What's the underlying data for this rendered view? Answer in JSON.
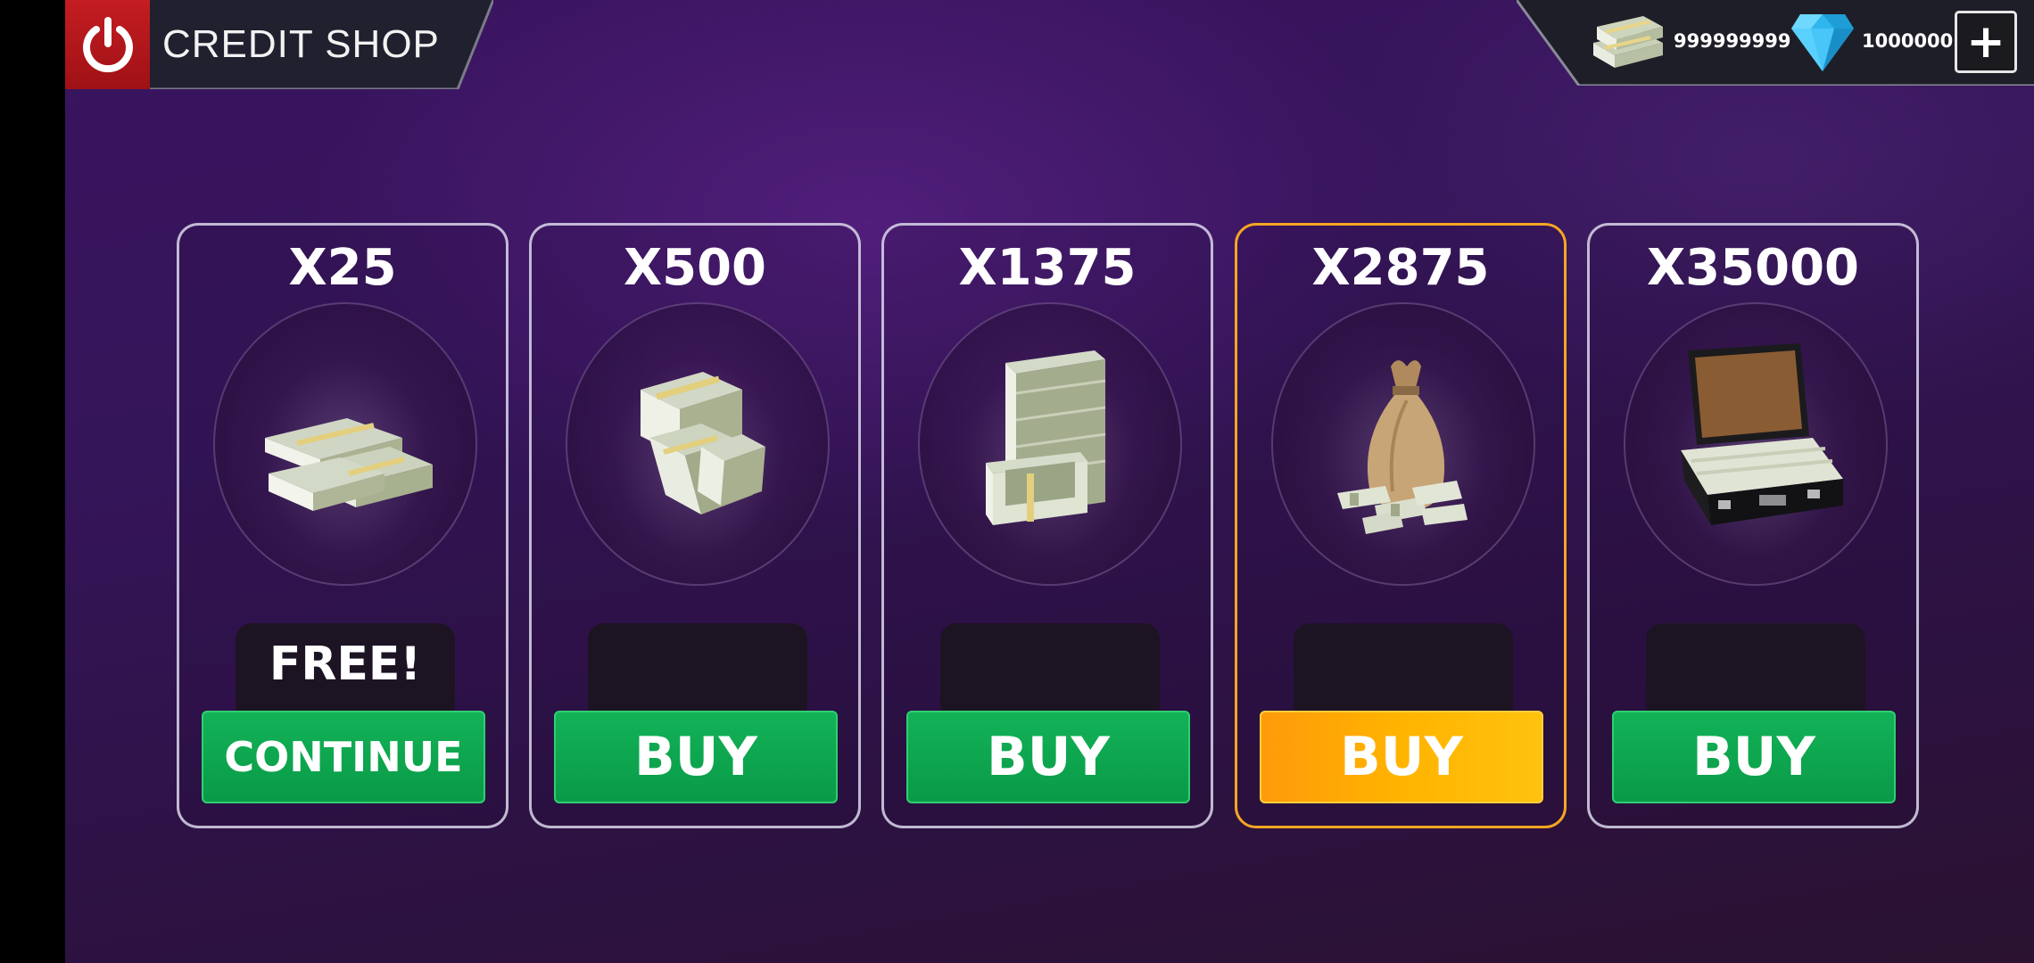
{
  "header": {
    "title": "CREDIT SHOP"
  },
  "currency": {
    "cash_amount": "999999999",
    "gem_amount": "1000000",
    "add_label": "+"
  },
  "colors": {
    "accent_green": "#0a9a47",
    "accent_orange": "#ffb400",
    "power_red": "#c41d22",
    "featured_border": "#f5a623"
  },
  "cards": [
    {
      "amount": "X25",
      "icon": "cash-stacks-icon",
      "price": "FREE!",
      "button": "CONTINUE",
      "featured": false
    },
    {
      "amount": "X500",
      "icon": "cash-bundles-icon",
      "price": "",
      "button": "BUY",
      "featured": false
    },
    {
      "amount": "X1375",
      "icon": "cash-pile-icon",
      "price": "",
      "button": "BUY",
      "featured": false
    },
    {
      "amount": "X2875",
      "icon": "money-bag-icon",
      "price": "",
      "button": "BUY",
      "featured": true
    },
    {
      "amount": "X35000",
      "icon": "cash-briefcase-icon",
      "price": "",
      "button": "BUY",
      "featured": false
    }
  ]
}
